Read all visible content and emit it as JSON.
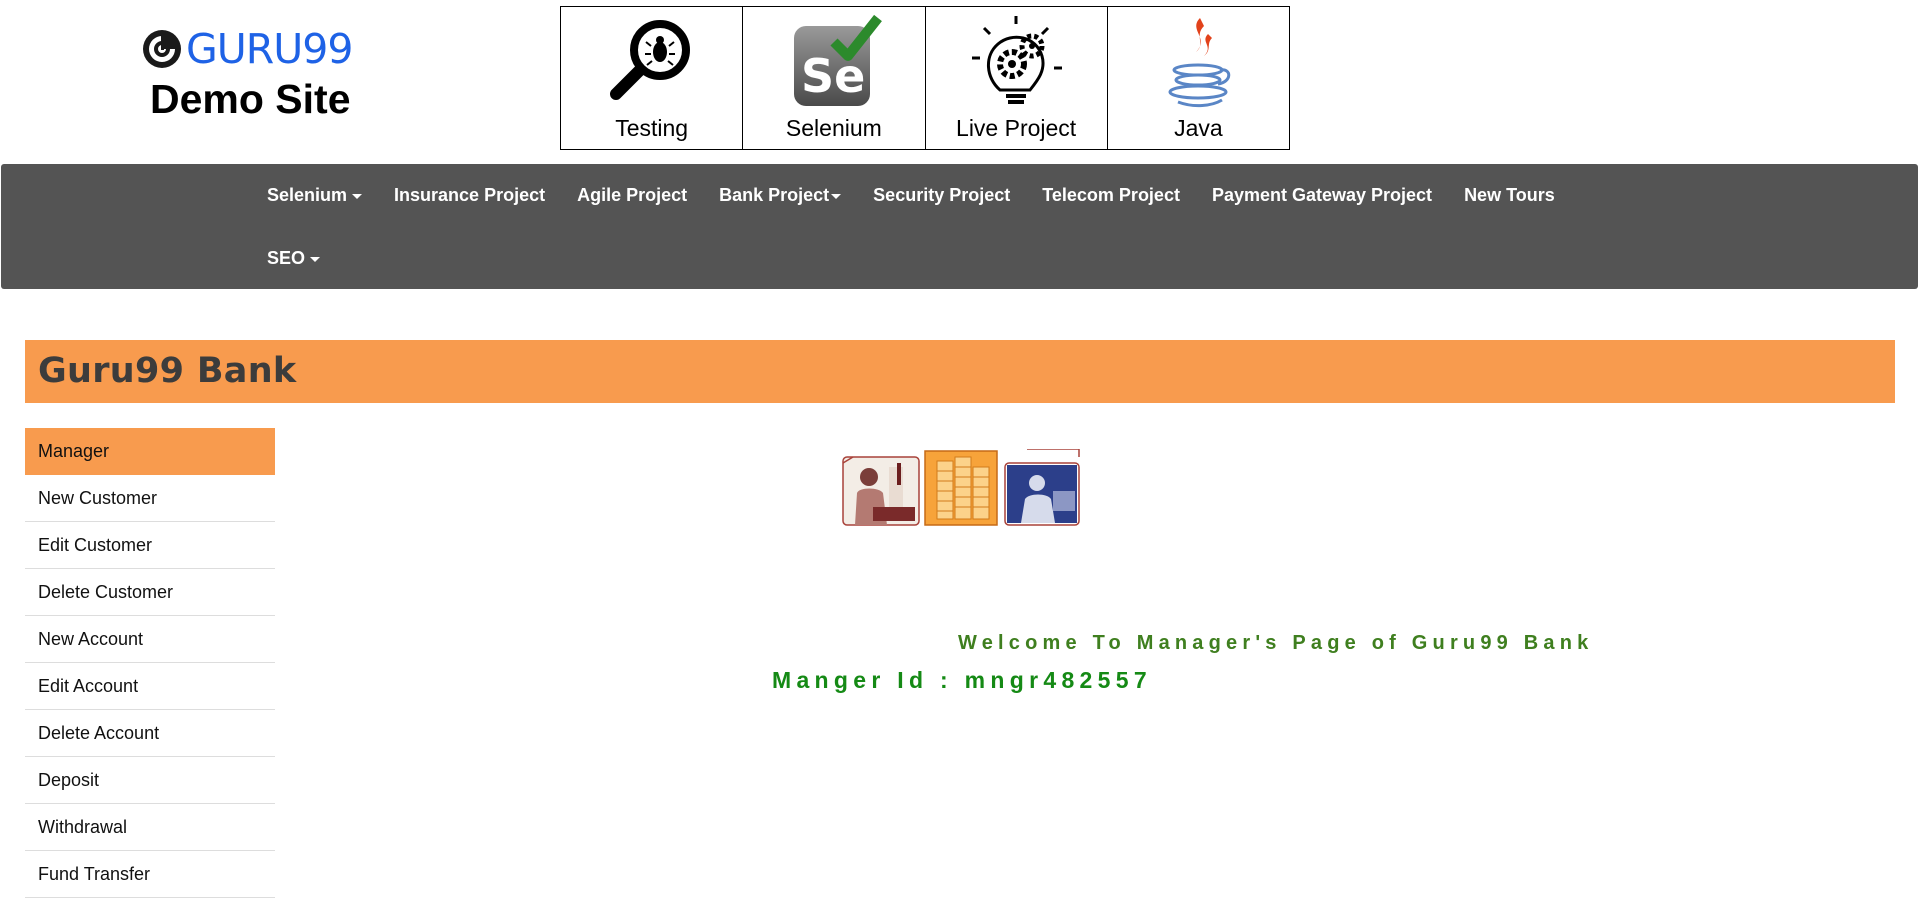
{
  "header": {
    "logo_text": "GURU99",
    "site_title": "Demo Site",
    "categories": [
      {
        "label": "Testing",
        "icon": "magnifier-bug-icon"
      },
      {
        "label": "Selenium",
        "icon": "selenium-check-icon"
      },
      {
        "label": "Live Project",
        "icon": "lightbulb-gears-icon"
      },
      {
        "label": "Java",
        "icon": "java-cup-icon"
      }
    ]
  },
  "nav": {
    "items": [
      {
        "label": "Selenium",
        "dropdown": true
      },
      {
        "label": "Insurance Project",
        "dropdown": false
      },
      {
        "label": "Agile Project",
        "dropdown": false
      },
      {
        "label": "Bank Project",
        "dropdown": true
      },
      {
        "label": "Security Project",
        "dropdown": false
      },
      {
        "label": "Telecom Project",
        "dropdown": false
      },
      {
        "label": "Payment Gateway Project",
        "dropdown": false
      },
      {
        "label": "New Tours",
        "dropdown": false
      },
      {
        "label": "SEO",
        "dropdown": true
      }
    ]
  },
  "bank": {
    "title": "Guru99 Bank"
  },
  "sidebar": {
    "items": [
      {
        "label": "Manager",
        "active": true
      },
      {
        "label": "New Customer"
      },
      {
        "label": "Edit Customer"
      },
      {
        "label": "Delete Customer"
      },
      {
        "label": "New Account"
      },
      {
        "label": "Edit Account"
      },
      {
        "label": "Delete Account"
      },
      {
        "label": "Deposit"
      },
      {
        "label": "Withdrawal"
      },
      {
        "label": "Fund Transfer"
      }
    ]
  },
  "main": {
    "welcome": "Welcome To Manager's Page of Guru99 Bank",
    "manager_id": "Manger Id : mngr482557"
  },
  "colors": {
    "nav_bg": "#545454",
    "accent_orange": "#f89b4e",
    "logo_blue": "#1e62e6",
    "welcome_green": "#3f7f1f",
    "manager_id_green": "#158a15"
  }
}
